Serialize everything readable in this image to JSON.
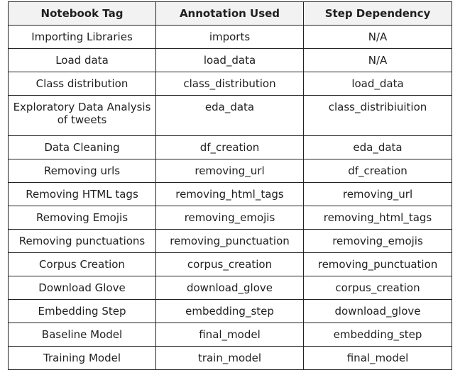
{
  "table": {
    "headers": [
      "Notebook Tag",
      "Annotation Used",
      "Step Dependency"
    ],
    "rows": [
      [
        "Importing Libraries",
        "imports",
        "N/A"
      ],
      [
        "Load data",
        "load_data",
        "N/A"
      ],
      [
        "Class distribution",
        "class_distribution",
        "load_data"
      ],
      [
        "Exploratory Data Analysis of tweets",
        "eda_data",
        "class_distribiuition"
      ],
      [
        "Data Cleaning",
        "df_creation",
        "eda_data"
      ],
      [
        "Removing urls",
        "removing_url",
        "df_creation"
      ],
      [
        "Removing HTML tags",
        "removing_html_tags",
        "removing_url"
      ],
      [
        "Removing Emojis",
        "removing_emojis",
        "removing_html_tags"
      ],
      [
        "Removing punctuations",
        "removing_punctuation",
        "removing_emojis"
      ],
      [
        "Corpus Creation",
        "corpus_creation",
        "removing_punctuation"
      ],
      [
        "Download Glove",
        "download_glove",
        "corpus_creation"
      ],
      [
        "Embedding Step",
        "embedding_step",
        "download_glove"
      ],
      [
        "Baseline Model",
        "final_model",
        "embedding_step"
      ],
      [
        "Training Model",
        "train_model",
        "final_model"
      ]
    ]
  }
}
